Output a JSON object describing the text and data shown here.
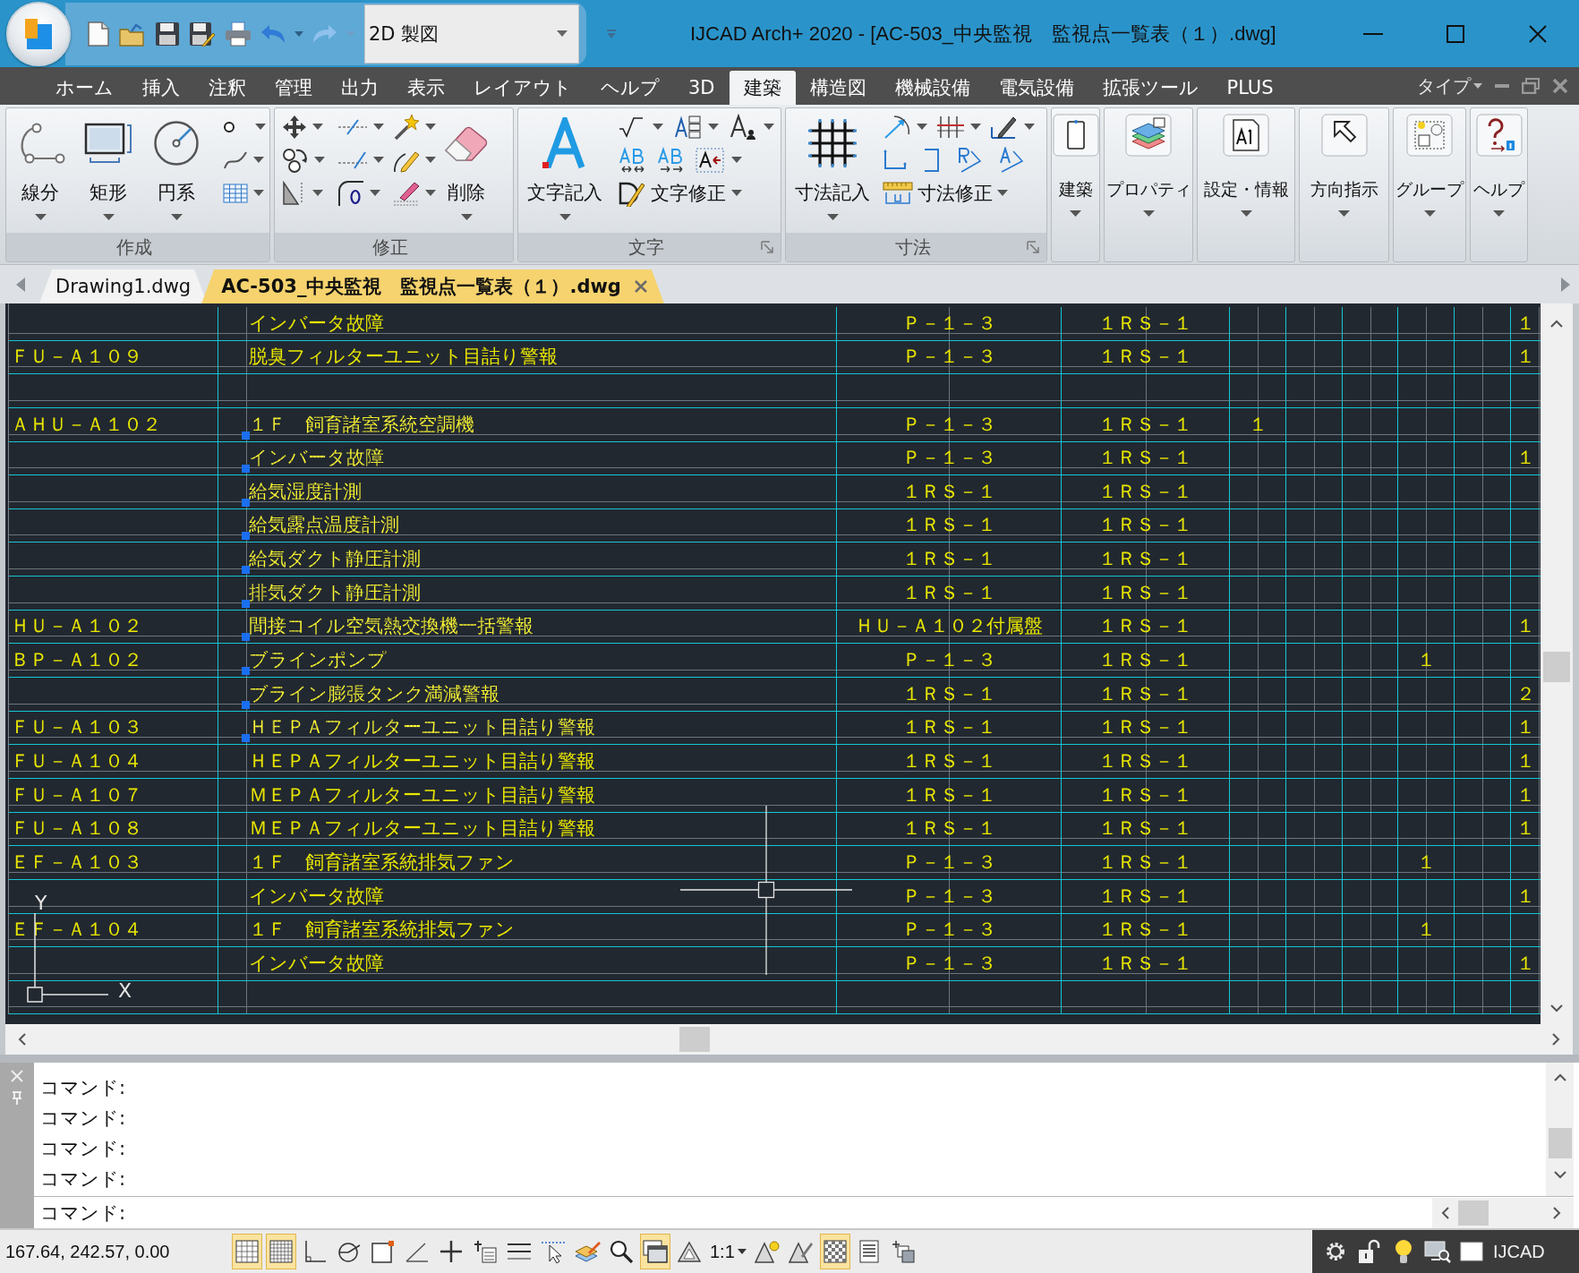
{
  "title_bar": {
    "workspace": "2D 製図",
    "title": "IJCAD Arch+ 2020 - [AC-503_中央監視　監視点一覧表（１）.dwg]"
  },
  "menu_tabs": [
    {
      "label": "ホーム",
      "selected": false
    },
    {
      "label": "挿入",
      "selected": false
    },
    {
      "label": "注釈",
      "selected": false
    },
    {
      "label": "管理",
      "selected": false
    },
    {
      "label": "出力",
      "selected": false
    },
    {
      "label": "表示",
      "selected": false
    },
    {
      "label": "レイアウト",
      "selected": false
    },
    {
      "label": "ヘルプ",
      "selected": false
    },
    {
      "label": "3D",
      "selected": false
    },
    {
      "label": "建築",
      "selected": true
    },
    {
      "label": "構造図",
      "selected": false
    },
    {
      "label": "機械設備",
      "selected": false
    },
    {
      "label": "電気設備",
      "selected": false
    },
    {
      "label": "拡張ツール",
      "selected": false
    },
    {
      "label": "PLUS",
      "selected": false
    }
  ],
  "menu_right": {
    "label": "タイプ"
  },
  "ribbon": {
    "panels": [
      {
        "title": "作成",
        "buttons": [
          "線分",
          "矩形",
          "円系"
        ]
      },
      {
        "title": "修正",
        "buttons": [
          "削除"
        ]
      },
      {
        "title": "文字",
        "buttons": [
          "文字記入",
          "文字修正"
        ]
      },
      {
        "title": "寸法",
        "buttons": [
          "寸法記入",
          "寸法修正"
        ]
      }
    ],
    "tools": [
      "建築",
      "プロパティ",
      "設定・情報",
      "方向指示",
      "グループ",
      "ヘルプ"
    ]
  },
  "document_tabs": [
    {
      "label": "Drawing1.dwg",
      "selected": false
    },
    {
      "label": "AC-503_中央監視　監視点一覧表（１）.dwg",
      "selected": true
    }
  ],
  "drawing_table": {
    "rows": [
      {
        "column_2": "インバータ故障",
        "column_3": "Ｐ－１－３",
        "column_4": "１ＲＳ－１",
        "column_10": "１",
        "selected": false
      },
      {
        "column_1": "ＦＵ－Ａ１０９",
        "column_2": "脱臭フィルターユニット目詰り警報",
        "column_3": "Ｐ－１－３",
        "column_4": "１ＲＳ－１",
        "column_10": "１",
        "selected": false
      },
      {
        "selected": false
      },
      {
        "column_1": "ＡＨＵ－Ａ１０２",
        "column_2": "１Ｆ　飼育諸室系統空調機",
        "column_3": "Ｐ－１－３",
        "column_4": "１ＲＳ－１",
        "column_5": "１",
        "selected": true
      },
      {
        "column_2": "インバータ故障",
        "column_3": "Ｐ－１－３",
        "column_4": "１ＲＳ－１",
        "column_10": "１",
        "selected": true
      },
      {
        "column_2": "給気湿度計測",
        "column_3": "１ＲＳ－１",
        "column_4": "１ＲＳ－１",
        "selected": true
      },
      {
        "column_2": "給気露点温度計測",
        "column_3": "１ＲＳ－１",
        "column_4": "１ＲＳ－１",
        "selected": true
      },
      {
        "column_2": "給気ダクト静圧計測",
        "column_3": "１ＲＳ－１",
        "column_4": "１ＲＳ－１",
        "selected": true
      },
      {
        "column_2": "排気ダクト静圧計測",
        "column_3": "１ＲＳ－１",
        "column_4": "１ＲＳ－１",
        "selected": true
      },
      {
        "column_1": "ＨＵ－Ａ１０２",
        "column_2": "間接コイル空気熱交換機一括警報",
        "column_3": "ＨＵ－Ａ１０２付属盤",
        "column_4": "１ＲＳ－１",
        "column_10": "１",
        "selected": true
      },
      {
        "column_1": "ＢＰ－Ａ１０２",
        "column_2": "ブラインポンプ",
        "column_3": "Ｐ－１－３",
        "column_4": "１ＲＳ－１",
        "column_8": "１",
        "selected": true
      },
      {
        "column_2": "ブライン膨張タンク満減警報",
        "column_3": "１ＲＳ－１",
        "column_4": "１ＲＳ－１",
        "column_10": "２",
        "selected": true
      },
      {
        "column_1": "ＦＵ－Ａ１０３",
        "column_2": "ＨＥＰＡフィルターユニット目詰り警報",
        "column_3": "１ＲＳ－１",
        "column_4": "１ＲＳ－１",
        "column_10": "１",
        "selected": true
      },
      {
        "column_1": "ＦＵ－Ａ１０４",
        "column_2": "ＨＥＰＡフィルターユニット目詰り警報",
        "column_3": "１ＲＳ－１",
        "column_4": "１ＲＳ－１",
        "column_10": "１",
        "selected": false
      },
      {
        "column_1": "ＦＵ－Ａ１０７",
        "column_2": "ＭＥＰＡフィルターユニット目詰り警報",
        "column_3": "１ＲＳ－１",
        "column_4": "１ＲＳ－１",
        "column_10": "１",
        "selected": false
      },
      {
        "column_1": "ＦＵ－Ａ１０８",
        "column_2": "ＭＥＰＡフィルターユニット目詰り警報",
        "column_3": "１ＲＳ－１",
        "column_4": "１ＲＳ－１",
        "column_10": "１",
        "selected": false
      },
      {
        "column_1": "ＥＦ－Ａ１０３",
        "column_2": "１Ｆ　飼育諸室系統排気ファン",
        "column_3": "Ｐ－１－３",
        "column_4": "１ＲＳ－１",
        "column_8": "１",
        "selected": false
      },
      {
        "column_2": "インバータ故障",
        "column_3": "Ｐ－１－３",
        "column_4": "１ＲＳ－１",
        "column_10": "１",
        "selected": false
      },
      {
        "column_1": "ＥＦ－Ａ１０４",
        "column_2": "１Ｆ　飼育諸室系統排気ファン",
        "column_3": "Ｐ－１－３",
        "column_4": "１ＲＳ－１",
        "column_8": "１",
        "selected": false
      },
      {
        "column_2": "インバータ故障",
        "column_3": "Ｐ－１－３",
        "column_4": "１ＲＳ－１",
        "column_10": "１",
        "selected": false
      },
      {
        "selected": false
      }
    ]
  },
  "ucs_icon": {
    "x_label": "X",
    "y_label": "Y"
  },
  "command_line": {
    "history": [
      "コマンド:",
      "コマンド:",
      "コマンド:",
      "コマンド:"
    ],
    "prompt": "コマンド:"
  },
  "status_bar": {
    "coordinates": "167.64, 242.57, 0.00",
    "toggles": [
      {
        "on": true
      },
      {
        "on": true
      },
      {
        "on": false
      },
      {
        "on": false
      },
      {
        "on": false
      },
      {
        "on": false
      },
      {
        "on": false
      },
      {
        "on": false
      },
      {
        "on": false
      },
      {
        "on": false
      },
      {
        "on": false
      },
      {
        "on": false
      },
      {
        "on": true
      },
      {
        "on": false
      }
    ],
    "annotation_scale": "1:1",
    "display_toggles": [
      {
        "on": false
      },
      {
        "on": false
      },
      {
        "on": true
      },
      {
        "on": false
      },
      {
        "on": false
      }
    ],
    "workspace": "IJCAD"
  }
}
